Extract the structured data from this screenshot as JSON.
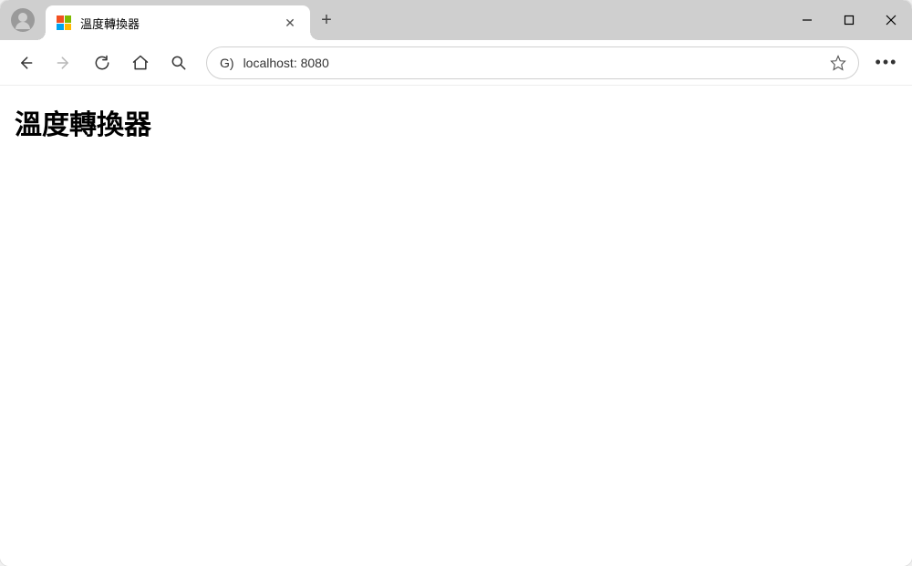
{
  "tab": {
    "title": "溫度轉換器"
  },
  "address": {
    "prefix": "G)",
    "url": "localhost: 8080"
  },
  "page": {
    "heading": "溫度轉換器"
  }
}
